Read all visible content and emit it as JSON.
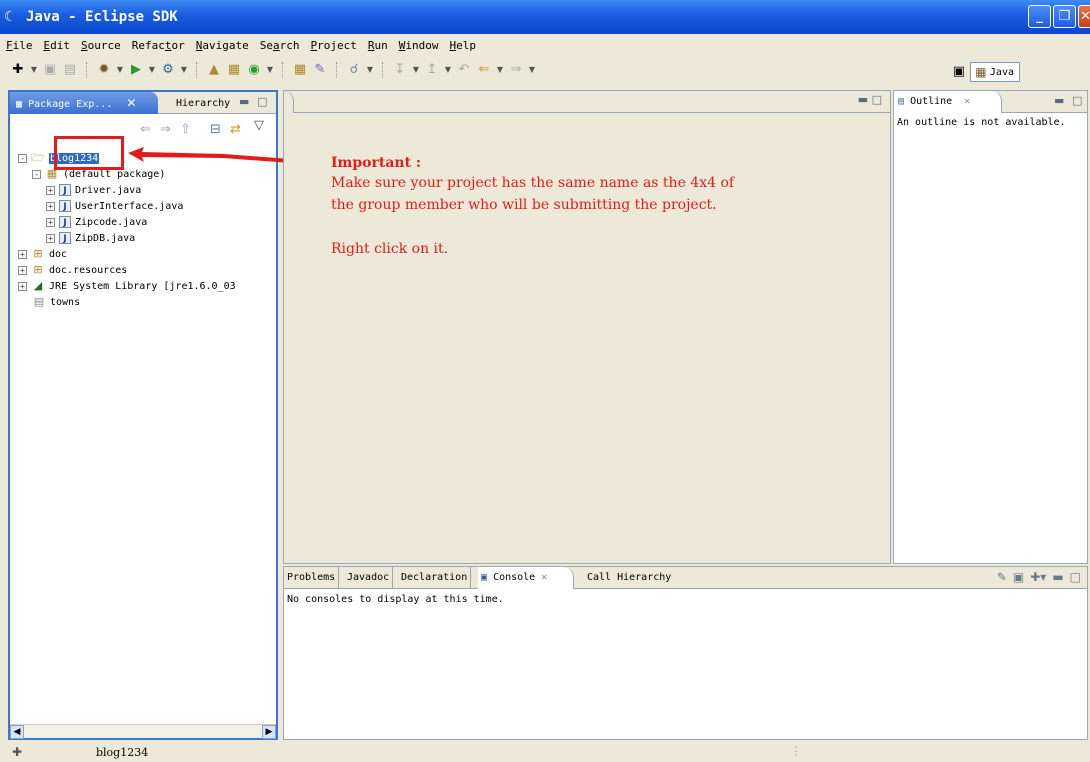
{
  "window": {
    "title": "Java - Eclipse SDK"
  },
  "menu": [
    "File",
    "Edit",
    "Source",
    "Refactor",
    "Navigate",
    "Search",
    "Project",
    "Run",
    "Window",
    "Help"
  ],
  "menu_mnemonics": [
    "F",
    "E",
    "S",
    "t",
    "N",
    "a",
    "P",
    "R",
    "W",
    "H"
  ],
  "perspective": {
    "label": "Java"
  },
  "left_panel": {
    "tab_active": "Package Exp...",
    "tab_inactive": "Hierarchy",
    "tree": [
      {
        "label": "blog1234",
        "icon": "project-icon",
        "expander": "-"
      },
      {
        "label": "(default package)",
        "icon": "package-icon",
        "expander": "-"
      },
      {
        "label": "Driver.java",
        "icon": "java-file-icon",
        "expander": "+"
      },
      {
        "label": "UserInterface.java",
        "icon": "java-file-icon",
        "expander": "+"
      },
      {
        "label": "Zipcode.java",
        "icon": "java-file-icon",
        "expander": "+"
      },
      {
        "label": "ZipDB.java",
        "icon": "java-file-icon",
        "expander": "+"
      },
      {
        "label": "doc",
        "icon": "folder-icon",
        "expander": "+"
      },
      {
        "label": "doc.resources",
        "icon": "folder-icon",
        "expander": "+"
      },
      {
        "label": "JRE System Library [jre1.6.0_03",
        "icon": "library-icon",
        "expander": "+"
      },
      {
        "label": "towns",
        "icon": "file-icon",
        "expander": ""
      }
    ]
  },
  "annotation": {
    "title": "Important :",
    "line1": "Make sure your project has the same name as the 4x4 of",
    "line2": "the group member who will be submitting the project.",
    "line3": "Right click on it.",
    "color": "#e41b1b"
  },
  "outline": {
    "tab": "Outline",
    "message": "An outline is not available."
  },
  "bottom": {
    "tabs": [
      "Problems",
      "Javadoc",
      "Declaration",
      "Console",
      "Call Hierarchy"
    ],
    "active_tab": "Console",
    "message": "No consoles to display at this time."
  },
  "status": {
    "text": "blog1234"
  },
  "colors": {
    "titlebar": "#0a46cf",
    "selection": "#316ac5",
    "chrome": "#ece9d8"
  }
}
